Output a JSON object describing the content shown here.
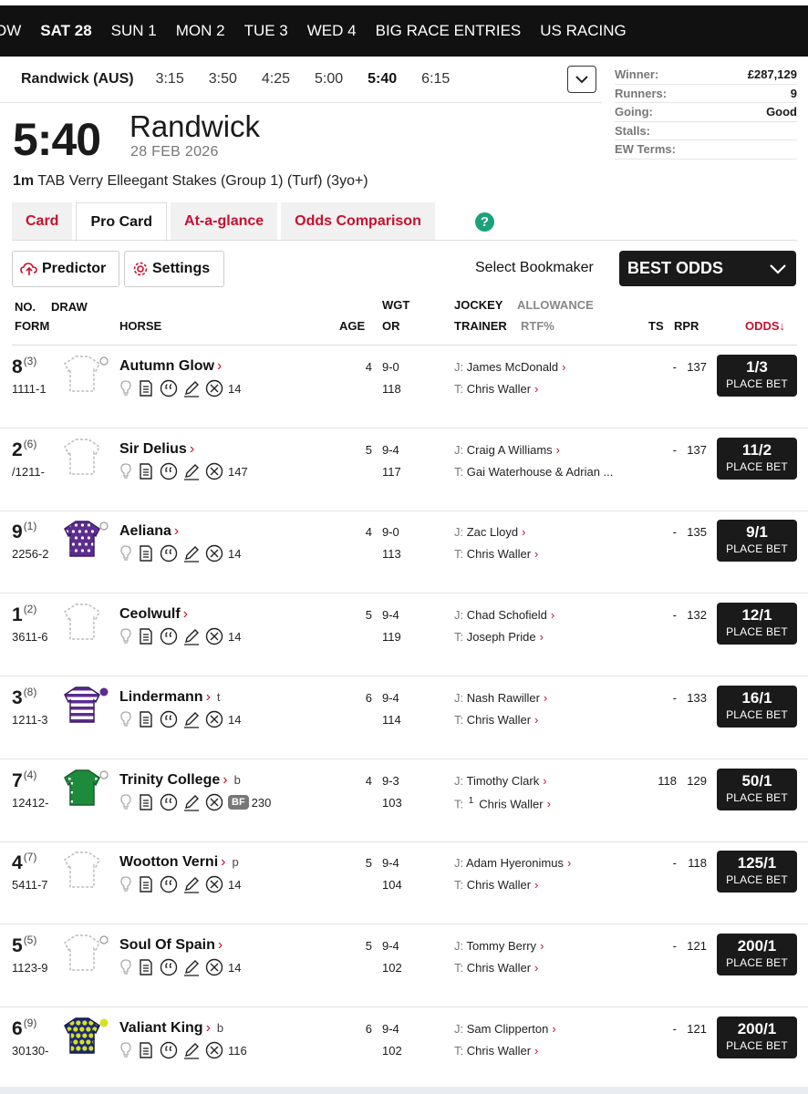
{
  "daynav": [
    "OW",
    "SAT 28",
    "SUN 1",
    "MON 2",
    "TUE 3",
    "WED 4",
    "BIG RACE ENTRIES",
    "US RACING"
  ],
  "daynav_active": "SAT 28",
  "meeting": {
    "course": "Randwick (AUS)",
    "times": [
      "3:15",
      "3:50",
      "4:25",
      "5:00",
      "5:40",
      "6:15"
    ],
    "active_time": "5:40"
  },
  "raceinfo": [
    {
      "k": "Winner:",
      "v": "£287,129"
    },
    {
      "k": "Runners:",
      "v": "9"
    },
    {
      "k": "Going:",
      "v": "Good"
    },
    {
      "k": "Stalls:",
      "v": ""
    },
    {
      "k": "EW Terms:",
      "v": ""
    }
  ],
  "race": {
    "time": "5:40",
    "course": "Randwick",
    "date": "28 FEB 2026",
    "distance": "1m",
    "title": "TAB Verry Elleegant Stakes (Group 1) (Turf) (3yo+)"
  },
  "tabs": [
    "Card",
    "Pro Card",
    "At-a-glance",
    "Odds Comparison"
  ],
  "active_tab": "Pro Card",
  "help_label": "?",
  "tools": {
    "predictor": "Predictor",
    "settings": "Settings"
  },
  "bookmaker": {
    "label": "Select Bookmaker",
    "value": "BEST ODDS"
  },
  "headers": {
    "no": "NO.",
    "draw": "DRAW",
    "form": "FORM",
    "horse": "HORSE",
    "age": "AGE",
    "wgt": "WGT",
    "or": "OR",
    "jockey": "JOCKEY",
    "allowance": "ALLOWANCE",
    "trainer": "TRAINER",
    "rtf": "RTF%",
    "ts": "TS",
    "rpr": "RPR",
    "odds": "ODDS↓"
  },
  "place_bet_label": "PLACE BET",
  "runners": [
    {
      "no": "8",
      "draw": "(3)",
      "form": "1111-1",
      "name": "Autumn Glow",
      "gear": "",
      "bf": "",
      "days": "14",
      "age": "4",
      "wgt": "9-0",
      "or": "118",
      "jockey": "James McDonald",
      "trainer": "Chris Waller",
      "trainer_sup": "",
      "ts": "-",
      "rpr": "137",
      "odds": "1/3",
      "silk": "plain",
      "cap": "ring"
    },
    {
      "no": "2",
      "draw": "(6)",
      "form": "/1211-",
      "name": "Sir Delius",
      "gear": "",
      "bf": "",
      "days": "147",
      "age": "5",
      "wgt": "9-4",
      "or": "117",
      "jockey": "Craig A Williams",
      "trainer": "Gai Waterhouse & Adrian ...",
      "trainer_sup": "",
      "ts": "-",
      "rpr": "137",
      "odds": "11/2",
      "silk": "plain",
      "cap": "none"
    },
    {
      "no": "9",
      "draw": "(1)",
      "form": "2256-2",
      "name": "Aeliana",
      "gear": "",
      "bf": "",
      "days": "14",
      "age": "4",
      "wgt": "9-0",
      "or": "113",
      "jockey": "Zac Lloyd",
      "trainer": "Chris Waller",
      "trainer_sup": "",
      "ts": "-",
      "rpr": "135",
      "odds": "9/1",
      "silk": "stars",
      "cap": "ring"
    },
    {
      "no": "1",
      "draw": "(2)",
      "form": "3611-6",
      "name": "Ceolwulf",
      "gear": "",
      "bf": "",
      "days": "14",
      "age": "5",
      "wgt": "9-4",
      "or": "119",
      "jockey": "Chad Schofield",
      "trainer": "Joseph Pride",
      "trainer_sup": "",
      "ts": "-",
      "rpr": "132",
      "odds": "12/1",
      "silk": "plain",
      "cap": "none"
    },
    {
      "no": "3",
      "draw": "(8)",
      "form": "1211-3",
      "name": "Lindermann",
      "gear": "t",
      "bf": "",
      "days": "14",
      "age": "6",
      "wgt": "9-4",
      "or": "114",
      "jockey": "Nash Rawiller",
      "trainer": "Chris Waller",
      "trainer_sup": "",
      "ts": "-",
      "rpr": "133",
      "odds": "16/1",
      "silk": "hoops",
      "cap": "purple"
    },
    {
      "no": "7",
      "draw": "(4)",
      "form": "12412-",
      "name": "Trinity College",
      "gear": "b",
      "bf": "BF",
      "days": "230",
      "age": "4",
      "wgt": "9-3",
      "or": "103",
      "jockey": "Timothy Clark",
      "trainer": "Chris Waller",
      "trainer_sup": "1",
      "ts": "118",
      "rpr": "129",
      "odds": "50/1",
      "silk": "green",
      "cap": "ring"
    },
    {
      "no": "4",
      "draw": "(7)",
      "form": "5411-7",
      "name": "Wootton Verni",
      "gear": "p",
      "bf": "",
      "days": "14",
      "age": "5",
      "wgt": "9-4",
      "or": "104",
      "jockey": "Adam Hyeronimus",
      "trainer": "Chris Waller",
      "trainer_sup": "",
      "ts": "-",
      "rpr": "118",
      "odds": "125/1",
      "silk": "plain",
      "cap": "none"
    },
    {
      "no": "5",
      "draw": "(5)",
      "form": "1123-9",
      "name": "Soul Of Spain",
      "gear": "",
      "bf": "",
      "days": "14",
      "age": "5",
      "wgt": "9-4",
      "or": "102",
      "jockey": "Tommy Berry",
      "trainer": "Chris Waller",
      "trainer_sup": "",
      "ts": "-",
      "rpr": "121",
      "odds": "200/1",
      "silk": "plain",
      "cap": "ring"
    },
    {
      "no": "6",
      "draw": "(9)",
      "form": "30130-",
      "name": "Valiant King",
      "gear": "b",
      "bf": "",
      "days": "116",
      "age": "6",
      "wgt": "9-4",
      "or": "102",
      "jockey": "Sam Clipperton",
      "trainer": "Chris Waller",
      "trainer_sup": "",
      "ts": "-",
      "rpr": "121",
      "odds": "200/1",
      "silk": "spots",
      "cap": "yellow"
    }
  ],
  "colors": {
    "accent_red": "#c8102e",
    "nav_bg": "#111111",
    "odds_bg": "#1a1a1a",
    "help_green": "#1ba27a"
  }
}
